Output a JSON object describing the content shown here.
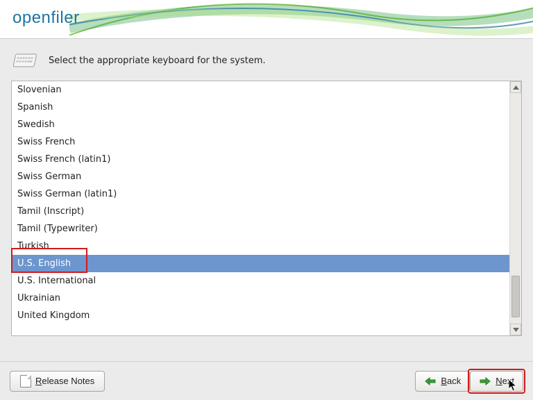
{
  "header": {
    "logo_text": "openfiler"
  },
  "instruction": {
    "text": "Select the appropriate keyboard for the system."
  },
  "keyboard_list": {
    "items": [
      "Slovenian",
      "Spanish",
      "Swedish",
      "Swiss French",
      "Swiss French (latin1)",
      "Swiss German",
      "Swiss German (latin1)",
      "Tamil (Inscript)",
      "Tamil (Typewriter)",
      "Turkish",
      "U.S. English",
      "U.S. International",
      "Ukrainian",
      "United Kingdom"
    ],
    "selected_index": 10
  },
  "footer": {
    "release_notes_label": "Release Notes",
    "back_label": "Back",
    "next_label": "Next"
  }
}
